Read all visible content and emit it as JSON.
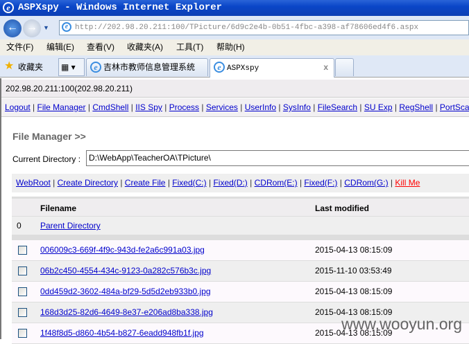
{
  "window": {
    "title": "ASPXspy - Windows Internet Explorer"
  },
  "address": {
    "host": "http://202.98.20.211",
    "rest": ":100/TPicture/6d9c2e4b-0b51-4fbc-a398-af78606ed4f6.aspx"
  },
  "menu": [
    "文件(F)",
    "编辑(E)",
    "查看(V)",
    "收藏夹(A)",
    "工具(T)",
    "帮助(H)"
  ],
  "favorites_label": "收藏夹",
  "tabs": [
    {
      "label": "吉林市教师信息管理系统"
    },
    {
      "label": "ASPXspy",
      "close": "x"
    }
  ],
  "info": "202.98.20.211:100(202.98.20.211)",
  "nav": [
    "Logout",
    "File Manager",
    "CmdShell",
    "IIS Spy",
    "Process",
    "Services",
    "UserInfo",
    "SysInfo",
    "FileSearch",
    "SU Exp",
    "RegShell",
    "PortScan"
  ],
  "heading": "File Manager >>",
  "current_directory": {
    "label": "Current Directory :",
    "value": "D:\\WebApp\\TeacherOA\\TPicture\\"
  },
  "links": [
    "WebRoot",
    "Create Directory",
    "Create File",
    "Fixed(C:)",
    "Fixed(D:)",
    "CDRom(E:)",
    "Fixed(F:)",
    "CDRom(G:)"
  ],
  "kill_me": "Kill Me",
  "colors": {
    "kill": "#ff0000",
    "link": "#0000cc"
  },
  "table": {
    "headers": [
      "Filename",
      "Last modified"
    ],
    "parent": {
      "index": "0",
      "label": "Parent Directory"
    },
    "rows": [
      {
        "name": "006009c3-669f-4f9c-943d-fe2a6c991a03.jpg",
        "modified": "2015-04-13 08:15:09"
      },
      {
        "name": "06b2c450-4554-434c-9123-0a282c576b3c.jpg",
        "modified": "2015-11-10 03:53:49"
      },
      {
        "name": "0dd459d2-3602-484a-bf29-5d5d2eb933b0.jpg",
        "modified": "2015-04-13 08:15:09"
      },
      {
        "name": "168d3d25-82d6-4649-8e37-e206ad8ba338.jpg",
        "modified": "2015-04-13 08:15:09"
      },
      {
        "name": "1f48f8d5-d860-4b54-b827-6eadd948fb1f.jpg",
        "modified": "2015-04-13 08:15:09"
      }
    ]
  },
  "watermark": "www.wooyun.org"
}
